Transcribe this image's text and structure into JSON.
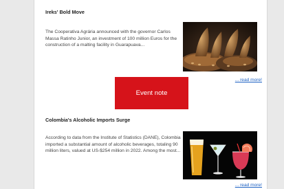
{
  "articles": [
    {
      "title": "Ireks' Bold Move",
      "summary": "The Cooperativa Agrária announced with the governor Carlos Massa Ratinho Junior, an investment of 100 million Euros for the construction of a malting facility in Guarapuava...",
      "read_more": "... read more!",
      "image_icon": "malt-grains-image"
    },
    {
      "title": "Colombia's Alcoholic Imports Surge",
      "summary": "According to data from the Institute of Statistics (DANE), Colombia imported a substantial amount of alcoholic beverages, totaling 90 million liters, valued at US-$254 million in 2022. Among the most...",
      "read_more": "... read more!",
      "image_icon": "drinks-glasses-image"
    }
  ],
  "event_button": {
    "label": "Event note"
  },
  "colors": {
    "accent_red": "#d6131a",
    "link_blue": "#1a5fc2",
    "page_background": "#e9e9e9",
    "card_background": "#ffffff"
  }
}
